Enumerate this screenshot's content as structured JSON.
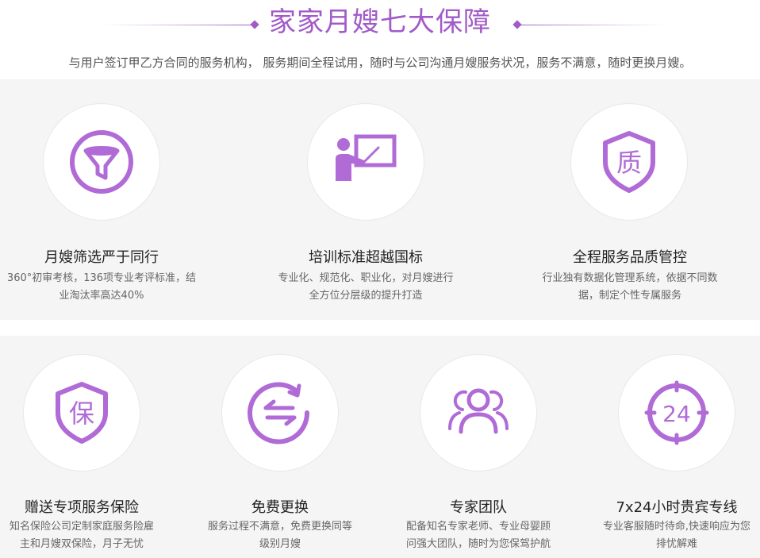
{
  "header": {
    "title": "家家月嫂七大保障",
    "subtitle": "与用户签订甲乙方合同的服务机构， 服务期间全程试用，随时与公司沟通月嫂服务状况，服务不满意，随时更换月嫂。"
  },
  "colors": {
    "accent": "#a25ac8",
    "icon": "#b06bd6",
    "background": "#f5f5f5"
  },
  "features": [
    {
      "icon": "funnel-icon",
      "title": "月嫂筛选严于同行",
      "desc_line1": "360°初审考核，136项专业考评标准，结",
      "desc_line2": "业淘汰率高达40%"
    },
    {
      "icon": "trainer-board-icon",
      "title": "培训标准超越国标",
      "desc_line1": "专业化、规范化、职业化，对月嫂进行",
      "desc_line2": "全方位分层级的提升打造"
    },
    {
      "icon": "quality-shield-icon",
      "title": "全程服务品质管控",
      "desc_line1": "行业独有数据化管理系统，依据不同数",
      "desc_line2": "据，制定个性专属服务",
      "icon_char": "质"
    },
    {
      "icon": "insurance-shield-icon",
      "title": "赠送专项服务保险",
      "desc_line1": "知名保险公司定制家庭服务险雇",
      "desc_line2": "主和月嫂双保险，月子无忧",
      "icon_char": "保"
    },
    {
      "icon": "exchange-icon",
      "title": "免费更换",
      "desc_line1": "服务过程不满意，免费更换同等",
      "desc_line2": "级别月嫂"
    },
    {
      "icon": "team-icon",
      "title": "专家团队",
      "desc_line1": "配备知名专家老师、专业母婴顾",
      "desc_line2": "问强大团队，随时为您保驾护航"
    },
    {
      "icon": "clock-24-icon",
      "title": "7x24小时贵宾专线",
      "desc_line1": "专业客服随时待命,快速响应为您",
      "desc_line2": "排忧解难",
      "icon_char": "24"
    }
  ]
}
